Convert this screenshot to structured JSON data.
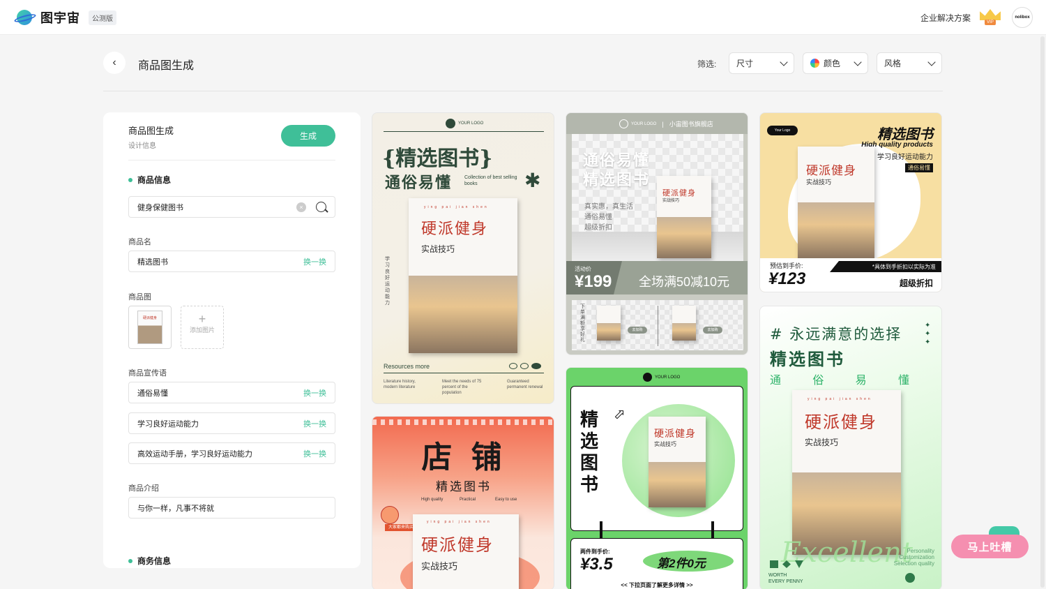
{
  "app": {
    "name": "图宇宙",
    "badge": "公测版",
    "enterprise": "企业解决方案",
    "vip_label": "VIP",
    "avatar_text": "nolibox"
  },
  "header": {
    "back": "‹",
    "title": "商品图生成",
    "filter_label": "筛选:",
    "filters": [
      "尺寸",
      "颜色",
      "风格"
    ]
  },
  "panel": {
    "title": "商品图生成",
    "subtitle": "设计信息",
    "generate": "生成",
    "product_info": "商品信息",
    "search_value": "健身保健图书",
    "clear": "×",
    "name_label": "商品名",
    "name_value": "精选图书",
    "swap": "换一换",
    "image_label": "商品图",
    "thumb_text": "硬派健身",
    "add_image": "添加图片",
    "add_plus": "+",
    "slogan_label": "商品宣传语",
    "slogans": [
      "通俗易懂",
      "学习良好运动能力",
      "高效运动手册，学习良好运动能力"
    ],
    "intro_label": "商品介绍",
    "intro_value": "与你一样，凡事不将就",
    "business_info": "商务信息"
  },
  "book": {
    "title": "硬派健身",
    "subtitle": "实战技巧",
    "pinyin": "ying  pai  jian  shen"
  },
  "card1": {
    "logo": "YOUR LOGO",
    "headline1": "{精选图书}",
    "headline2": "通俗易懂",
    "en": "Collection of best selling books",
    "vertical": "学习良好运动能力",
    "resources": "Resources more",
    "col1": "Literature history, modern literature",
    "col2": "Meet the needs of 75 percent of the population",
    "col3": "Guaranteed permanent renewal",
    "star": "✱"
  },
  "card2": {
    "logo": "YOUR LOGO",
    "shop": "小宙图书旗舰店",
    "headline1": "通俗易懂",
    "headline2": "精选图书",
    "lines": [
      "真实惠，真生活",
      "通俗易懂",
      "超级折扣"
    ],
    "price_label": "活动价",
    "price": "¥199",
    "promo": "全场满50减10元",
    "side": "下单满额享好礼",
    "add": "去加购"
  },
  "card3": {
    "logo_tag": "Your Logo",
    "headline": "精选图书",
    "en": "High quality products",
    "sub": "学习良好运动能力",
    "tag": "通俗易懂",
    "price_label": "预估到手价:",
    "note": "*具体到手折扣以实际为准",
    "price": "¥123",
    "discount": "超级折扣"
  },
  "card4": {
    "big": "店 铺",
    "sub": "精选图书",
    "tags": [
      "High quality",
      "Practical",
      "Easy to use"
    ],
    "stamp": "大家都来购买"
  },
  "card5": {
    "logo": "YOUR LOGO",
    "vertical": "精选图书",
    "price_label": "两件到手价:",
    "price": "¥3.5",
    "promo": "第2件0元",
    "more": "<< 下拉页面了解更多详情 >>"
  },
  "card6": {
    "headline1": "# 永远满意的选择",
    "headline2": "精选图书",
    "headline3": [
      "通",
      "俗",
      "易",
      "懂"
    ],
    "script": "Excellent",
    "en_right": [
      "Personality",
      "Customization",
      "Selection quality"
    ],
    "worth": [
      "WORTH",
      "EVERY PENNY"
    ]
  },
  "feedback": "马上吐槽"
}
